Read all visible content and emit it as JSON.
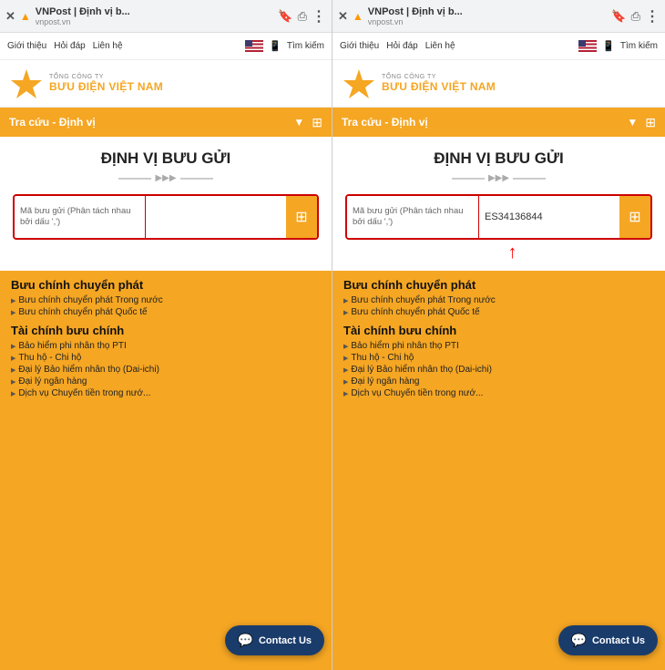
{
  "panels": [
    {
      "id": "left",
      "browser": {
        "close_label": "✕",
        "warning": "▲",
        "title": "VNPost | Định vị b...",
        "url": "vnpost.vn",
        "bookmark_icon": "🔖",
        "share_icon": "⎙",
        "more_icon": "⋮"
      },
      "topnav": {
        "items": [
          "Giới thiệu",
          "Hỏi đáp",
          "Liên hệ"
        ],
        "search_label": "Tìm kiếm"
      },
      "logo": {
        "sub": "TỔNG CÔNG TY",
        "main": "BƯU ĐIỆN VIỆT NAM"
      },
      "yellownav": {
        "text": "Tra cứu - Định vị"
      },
      "main": {
        "title": "ĐỊNH VỊ BƯU GỬI",
        "label": "Mã bưu gửi (Phân tách nhau bởi dấu ',')",
        "input_value": "",
        "has_arrow": false
      },
      "footer": {
        "col1_title": "Bưu chính chuyển phát",
        "col1_items": [
          "Bưu chính chuyển phát Trong nước",
          "Bưu chính chuyển phát Quốc tế"
        ],
        "col2_title": "Tài chính bưu chính",
        "col2_items": [
          "Bảo hiểm phi nhân thọ PTI",
          "Thu hộ - Chi hộ",
          "Đại lý Bảo hiểm nhân thọ (Dai-ichi)",
          "Đại lý ngân hàng",
          "Dịch vụ Chuyển tiền trong nướ..."
        ]
      },
      "contact_btn": "Contact Us"
    },
    {
      "id": "right",
      "browser": {
        "close_label": "✕",
        "warning": "▲",
        "title": "VNPost | Định vị b...",
        "url": "vnpost.vn",
        "bookmark_icon": "🔖",
        "share_icon": "⎙",
        "more_icon": "⋮"
      },
      "topnav": {
        "items": [
          "Giới thiệu",
          "Hỏi đáp",
          "Liên hệ"
        ],
        "search_label": "Tìm kiếm"
      },
      "logo": {
        "sub": "TỔNG CÔNG TY",
        "main": "BƯU ĐIỆN VIỆT NAM"
      },
      "yellownav": {
        "text": "Tra cứu - Định vị"
      },
      "main": {
        "title": "ĐỊNH VỊ BƯU GỬI",
        "label": "Mã bưu gửi (Phân tách nhau bởi dấu ',')",
        "input_value": "ES34136844",
        "has_arrow": true
      },
      "footer": {
        "col1_title": "Bưu chính chuyển phát",
        "col1_items": [
          "Bưu chính chuyển phát Trong nước",
          "Bưu chính chuyển phát Quốc tế"
        ],
        "col2_title": "Tài chính bưu chính",
        "col2_items": [
          "Bảo hiểm phi nhân thọ PTI",
          "Thu hộ - Chi hộ",
          "Đại lý Bảo hiểm nhân thọ (Dai-ichi)",
          "Đại lý ngân hàng",
          "Dịch vụ Chuyển tiền trong nướ..."
        ]
      },
      "contact_btn": "Contact Us"
    }
  ],
  "colors": {
    "yellow": "#f5a623",
    "dark_blue": "#1a3c6b",
    "red": "#cc0000"
  }
}
